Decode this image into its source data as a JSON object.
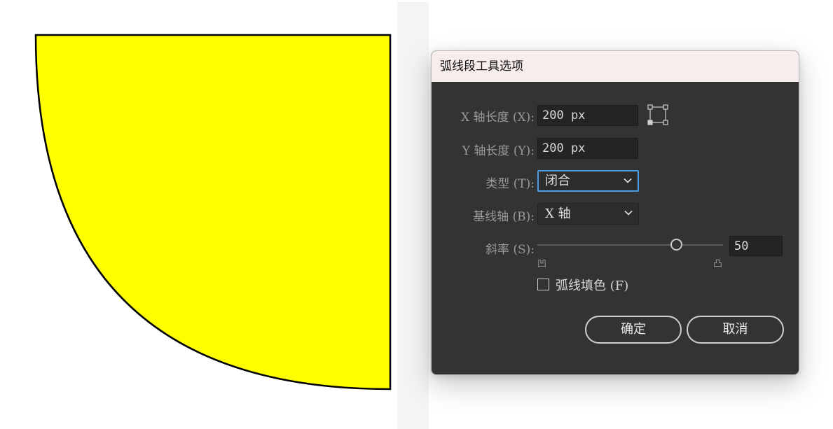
{
  "dialog": {
    "title": "弧线段工具选项",
    "x_length": {
      "label": "X 轴长度 (X):",
      "value": "200 px"
    },
    "y_length": {
      "label": "Y 轴长度 (Y):",
      "value": "200 px"
    },
    "type": {
      "label": "类型 (T):",
      "value": "闭合"
    },
    "base_axis": {
      "label": "基线轴 (B):",
      "value": "X 轴"
    },
    "slope": {
      "label": "斜率 (S):",
      "value": "50",
      "min_label": "凹",
      "max_label": "凸",
      "level": 0.75
    },
    "fill_arc": {
      "label": "弧线填色 (F)",
      "checked": false
    },
    "ok_label": "确定",
    "cancel_label": "取消"
  },
  "canvas": {
    "arc_fill_color": "#ffff00",
    "arc_stroke_color": "#000000"
  },
  "colors": {
    "dialog_bg": "#333333",
    "titlebar_bg": "#f7eded",
    "focus_ring": "#4a9ee8"
  },
  "icons": {
    "anchor": "reference-point-icon",
    "dropdown": "chevron-down-icon"
  }
}
